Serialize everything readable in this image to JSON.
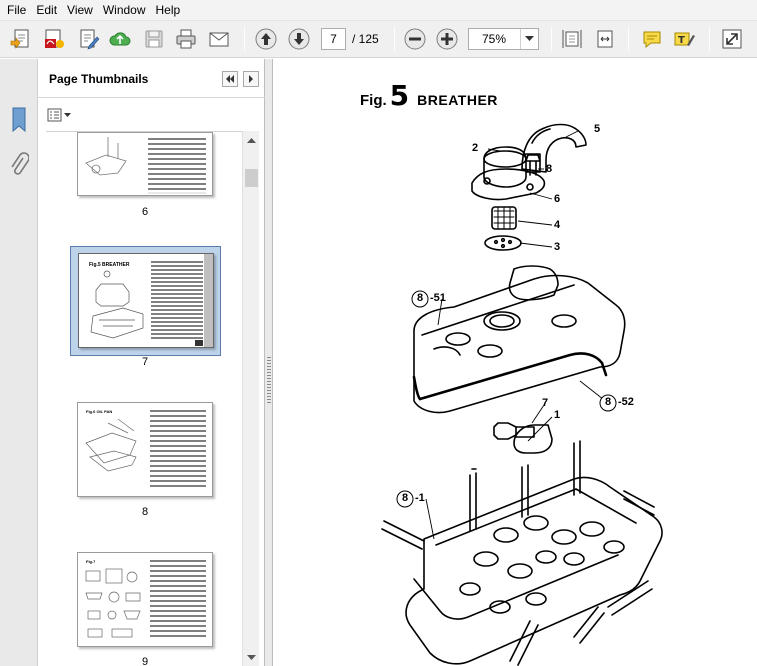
{
  "menu": [
    "File",
    "Edit",
    "View",
    "Window",
    "Help"
  ],
  "toolbar": {
    "icons": [
      "create-icon",
      "create-pdf-icon",
      "edit-icon",
      "upload-icon",
      "save-icon",
      "print-icon",
      "email-icon",
      "previous-page-icon",
      "next-page-icon",
      "zoom-out-icon",
      "zoom-in-icon",
      "fit-page-icon",
      "fit-width-icon",
      "comment-icon",
      "highlight-icon",
      "expand-icon"
    ],
    "current_page": "7",
    "page_total": "/ 125",
    "zoom": "75%"
  },
  "thumbnails": {
    "title": "Page Thumbnails",
    "pages": [
      {
        "label": "6",
        "selected": false
      },
      {
        "label": "7",
        "selected": true
      },
      {
        "label": "8",
        "selected": false
      },
      {
        "label": "9",
        "selected": false
      }
    ]
  },
  "document": {
    "fig_label": "Fig.",
    "fig_number": "5",
    "fig_name": "BREATHER",
    "callouts": [
      "5",
      "2",
      "8",
      "6",
      "4",
      "3",
      "8",
      "51",
      "8",
      "52",
      "7",
      "1",
      "8",
      "1"
    ]
  },
  "colors": {
    "selection_fill": "#bcd3ea",
    "selection_border": "#5c7da8",
    "toolbar_bg": "#f0f0f0"
  }
}
